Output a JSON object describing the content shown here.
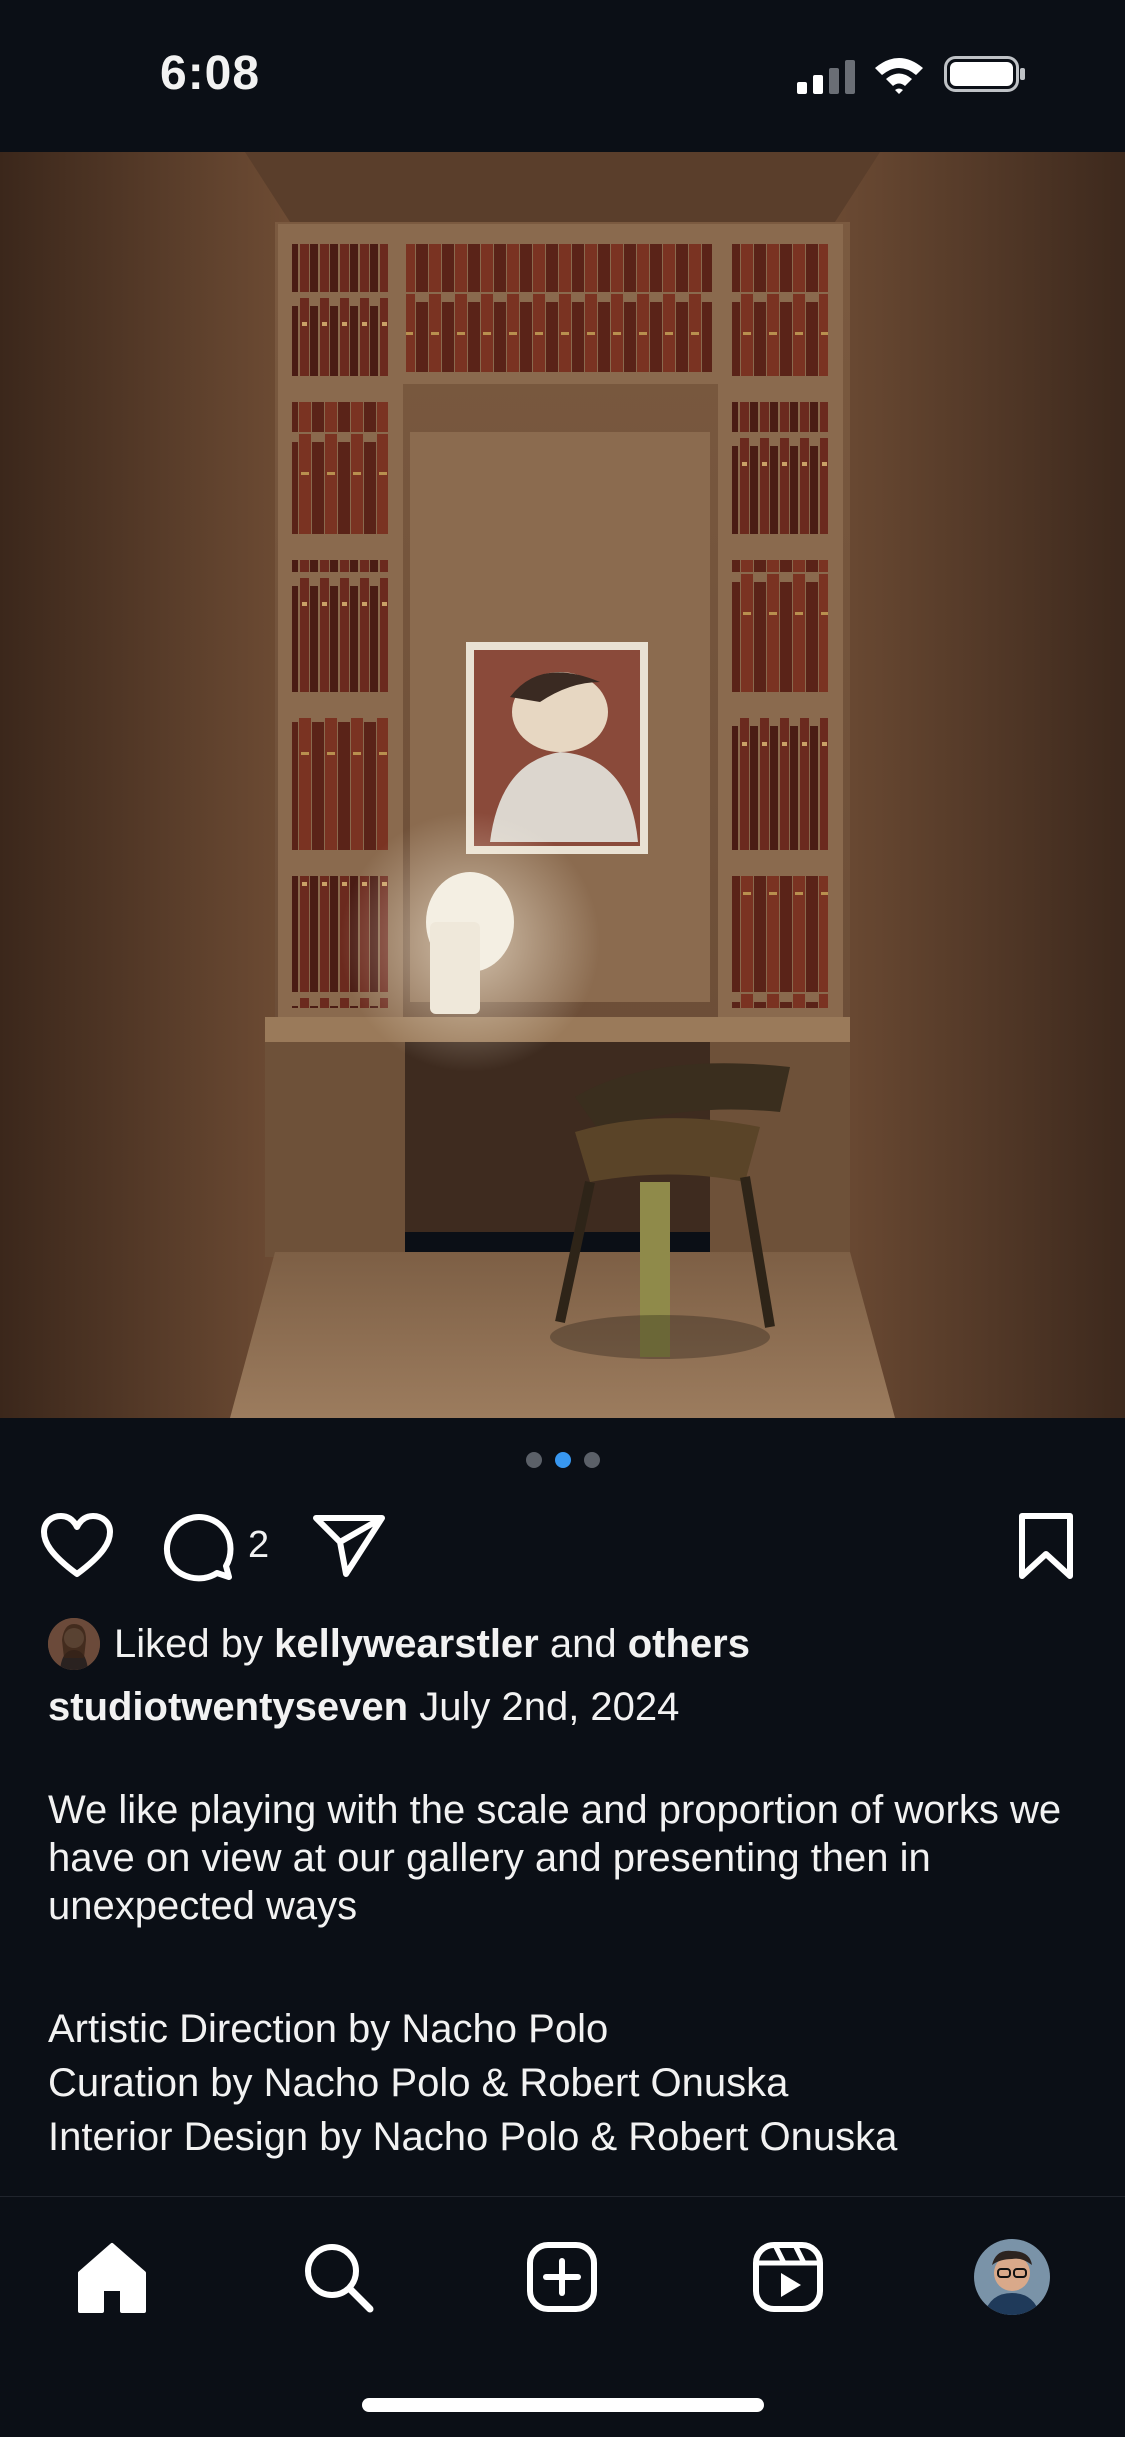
{
  "status_bar": {
    "time": "6:08"
  },
  "carousel": {
    "count": 3,
    "active_index": 1
  },
  "actions": {
    "comment_count": "2"
  },
  "likes": {
    "prefix": "Liked by ",
    "user": "kellywearstler",
    "middle": " and ",
    "suffix": "others"
  },
  "post": {
    "username": "studiotwentyseven",
    "date": "July 2nd, 2024",
    "caption": "We like playing with the scale and proportion of works we have on view at our gallery and presenting then in unexpected ways",
    "credits": [
      "Artistic Direction by Nacho Polo",
      "Curation by Nacho Polo & Robert Onuska",
      "Interior Design by Nacho Polo & Robert Onuska"
    ]
  },
  "colors": {
    "background": "#0b0f16",
    "active_dot": "#3897f0",
    "text": "#f2f2f2"
  },
  "icons": [
    "heart-icon",
    "comment-icon",
    "share-icon",
    "bookmark-icon",
    "home-icon",
    "search-icon",
    "create-icon",
    "reels-icon"
  ]
}
